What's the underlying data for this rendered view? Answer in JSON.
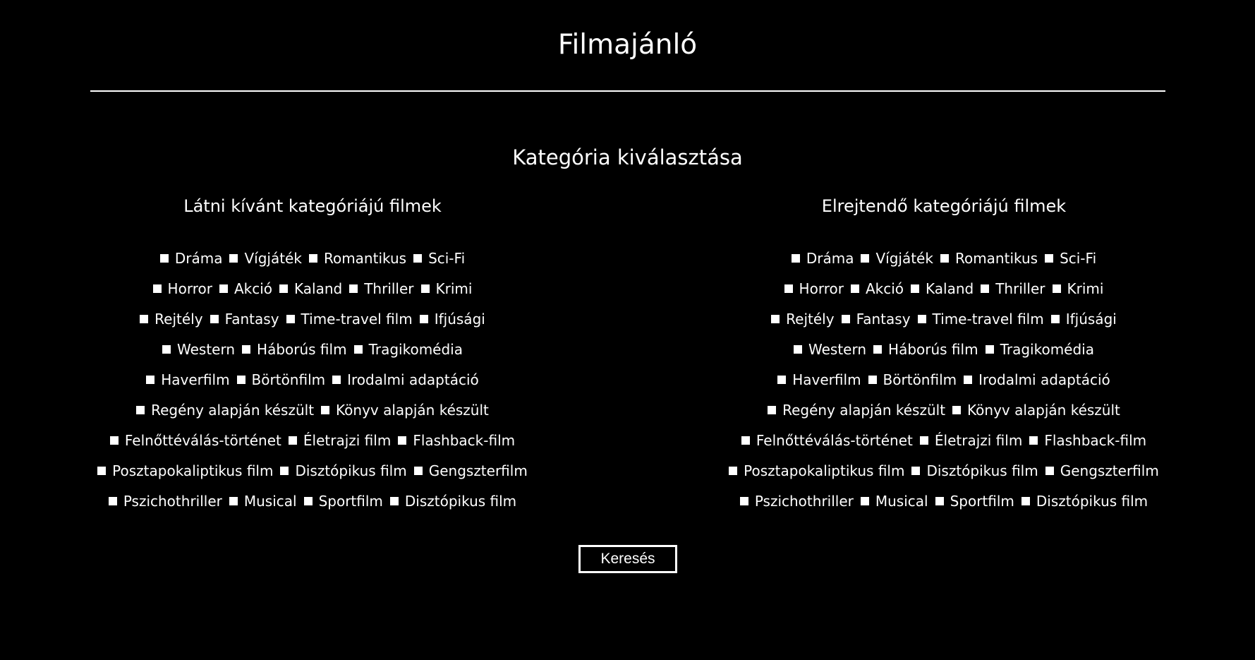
{
  "page": {
    "title": "Filmajánló"
  },
  "selection": {
    "title": "Kategória kiválasztása",
    "include": {
      "title": "Látni kívánt kategóriájú filmek"
    },
    "exclude": {
      "title": "Elrejtendő kategóriájú filmek"
    },
    "category_rows": [
      [
        "Dráma",
        "Vígjáték",
        "Romantikus",
        "Sci-Fi"
      ],
      [
        "Horror",
        "Akció",
        "Kaland",
        "Thriller",
        "Krimi"
      ],
      [
        "Rejtély",
        "Fantasy",
        "Time-travel film",
        "Ifjúsági"
      ],
      [
        "Western",
        "Háborús film",
        "Tragikomédia"
      ],
      [
        "Haverfilm",
        "Börtönfilm",
        "Irodalmi adaptáció"
      ],
      [
        "Regény alapján készült",
        "Könyv alapján készült"
      ],
      [
        "Felnőttéválás-történet",
        "Életrajzi film",
        "Flashback-film"
      ],
      [
        "Posztapokaliptikus film",
        "Disztópikus film",
        "Gengszterfilm"
      ],
      [
        "Pszichothriller",
        "Musical",
        "Sportfilm",
        "Disztópikus film"
      ]
    ],
    "checkbox_icon": "unchecked-square-icon"
  },
  "search": {
    "label": "Keresés"
  },
  "colors": {
    "background": "#000000",
    "foreground": "#ffffff"
  }
}
